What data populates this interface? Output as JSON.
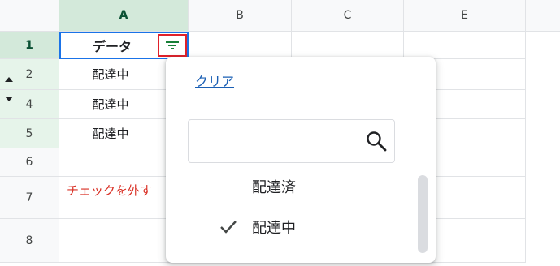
{
  "columns": [
    "A",
    "B",
    "C",
    "E"
  ],
  "rows": [
    "1",
    "2",
    "4",
    "5",
    "6",
    "7",
    "8"
  ],
  "cells": {
    "a1": "データ",
    "a2": "配達中",
    "a4": "配達中",
    "a5": "配達中"
  },
  "annotation": {
    "note": "チェックを外す"
  },
  "filter_popup": {
    "clear_label": "クリア",
    "search": {
      "value": "",
      "placeholder": ""
    },
    "values": [
      {
        "label": "配達済",
        "checked": false
      },
      {
        "label": "配達中",
        "checked": true
      }
    ]
  },
  "colors": {
    "selection_header": "#d3e9da",
    "selection_border": "#1a73e8",
    "highlight": "#e0202a",
    "link": "#1a5fb4"
  }
}
